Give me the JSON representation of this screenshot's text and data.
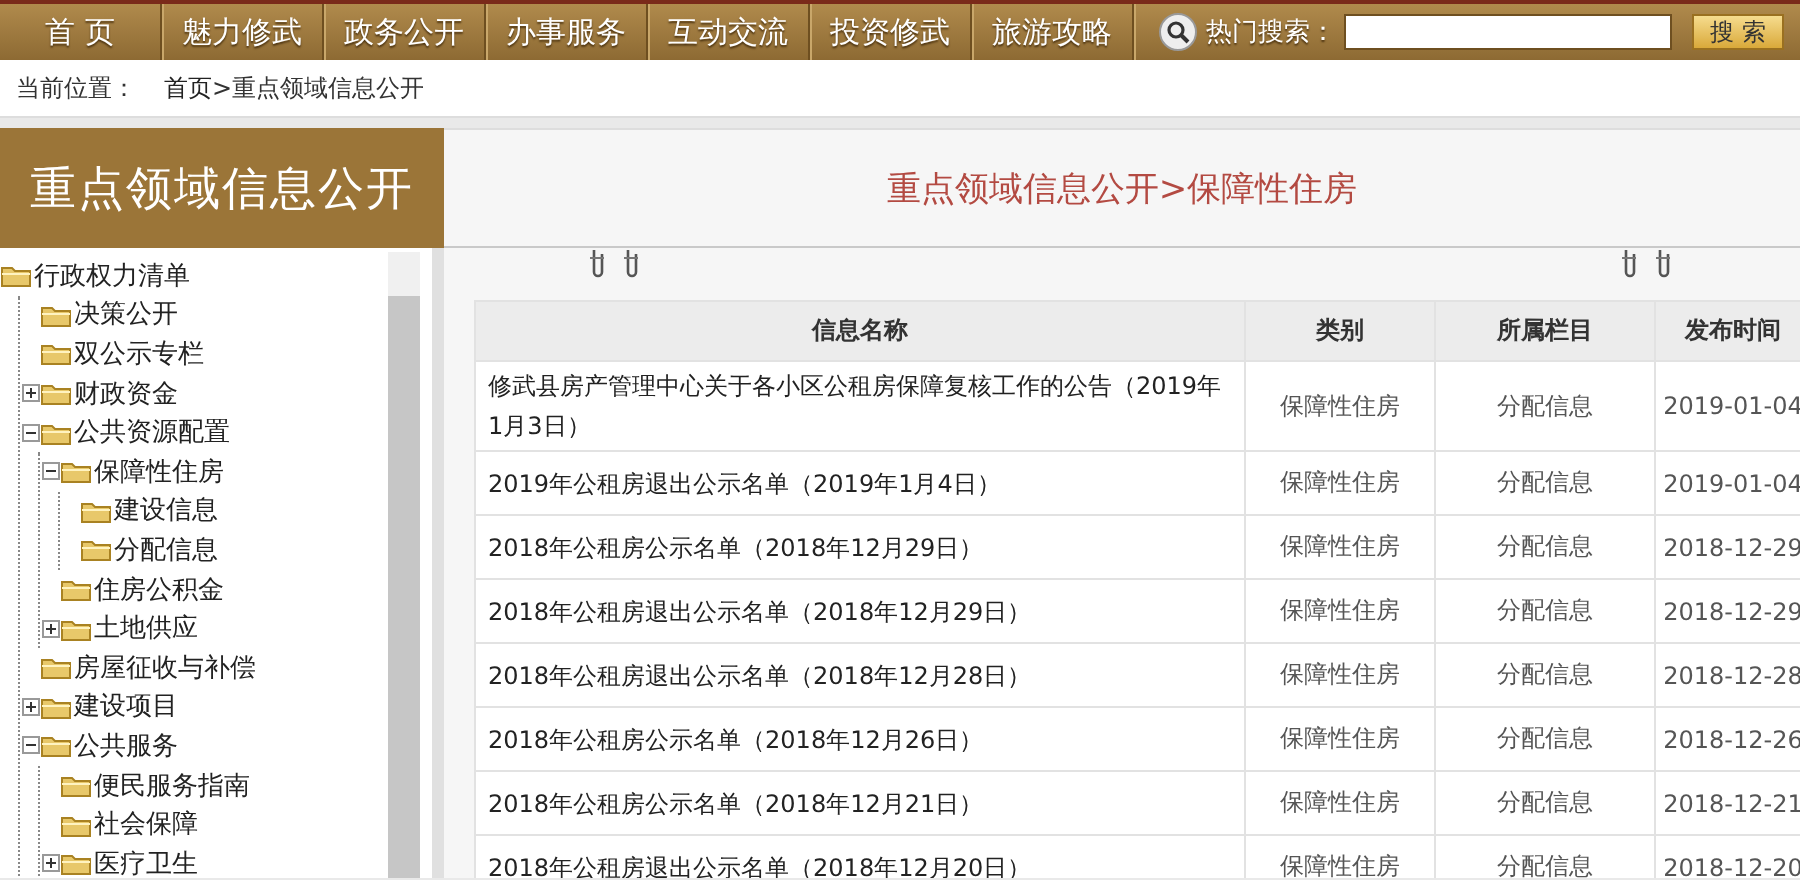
{
  "nav": {
    "items": [
      {
        "label": "首 页"
      },
      {
        "label": "魅力修武"
      },
      {
        "label": "政务公开"
      },
      {
        "label": "办事服务"
      },
      {
        "label": "互动交流"
      },
      {
        "label": "投资修武"
      },
      {
        "label": "旅游攻略"
      }
    ],
    "search": {
      "label": "热门搜索：",
      "button": "搜 索"
    }
  },
  "breadcrumb": {
    "label": "当前位置：",
    "path": [
      "首页",
      "重点领域信息公开"
    ],
    "separator": ">"
  },
  "sidebar": {
    "title": "重点领域信息公开",
    "tree": [
      {
        "label": "行政权力清单",
        "children": [
          {
            "label": "决策公开"
          },
          {
            "label": "双公示专栏"
          },
          {
            "label": "财政资金",
            "expanded": false
          },
          {
            "label": "公共资源配置",
            "expanded": true,
            "children": [
              {
                "label": "保障性住房",
                "expanded": true,
                "children": [
                  {
                    "label": "建设信息"
                  },
                  {
                    "label": "分配信息"
                  }
                ]
              },
              {
                "label": "住房公积金"
              },
              {
                "label": "土地供应",
                "expanded": false
              }
            ]
          },
          {
            "label": "房屋征收与补偿"
          },
          {
            "label": "建设项目",
            "expanded": false
          },
          {
            "label": "公共服务",
            "expanded": true,
            "children": [
              {
                "label": "便民服务指南"
              },
              {
                "label": "社会保障"
              },
              {
                "label": "医疗卫生",
                "expanded": false
              }
            ]
          }
        ]
      }
    ]
  },
  "content": {
    "title": "重点领域信息公开>保障性住房",
    "table": {
      "columns": [
        "信息名称",
        "类别",
        "所属栏目",
        "发布时间"
      ],
      "rows": [
        [
          "修武县房产管理中心关于各小区公租房保障复核工作的公告（2019年1月3日）",
          "保障性住房",
          "分配信息",
          "2019-01-04"
        ],
        [
          "2019年公租房退出公示名单（2019年1月4日）",
          "保障性住房",
          "分配信息",
          "2019-01-04"
        ],
        [
          "2018年公租房公示名单（2018年12月29日）",
          "保障性住房",
          "分配信息",
          "2018-12-29"
        ],
        [
          "2018年公租房退出公示名单（2018年12月29日）",
          "保障性住房",
          "分配信息",
          "2018-12-29"
        ],
        [
          "2018年公租房退出公示名单（2018年12月28日）",
          "保障性住房",
          "分配信息",
          "2018-12-28"
        ],
        [
          "2018年公租房公示名单（2018年12月26日）",
          "保障性住房",
          "分配信息",
          "2018-12-26"
        ],
        [
          "2018年公租房公示名单（2018年12月21日）",
          "保障性住房",
          "分配信息",
          "2018-12-21"
        ],
        [
          "2018年公租房退出公示名单（2018年12月20日）",
          "保障性住房",
          "分配信息",
          "2018-12-20"
        ]
      ]
    }
  }
}
